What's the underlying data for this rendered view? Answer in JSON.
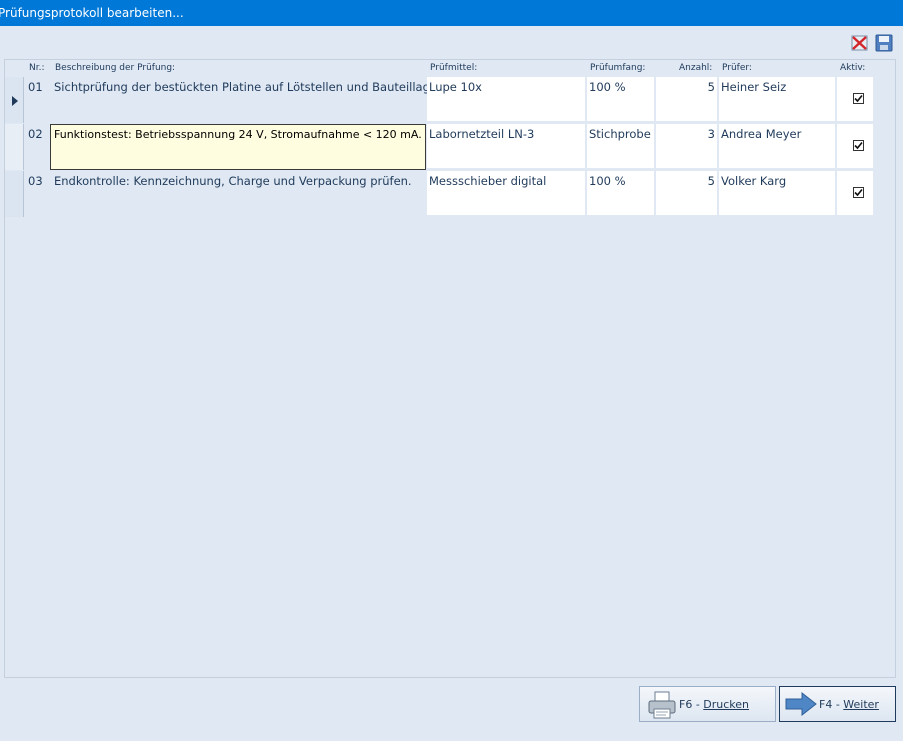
{
  "window": {
    "title": "Prüfungsprotokoll bearbeiten..."
  },
  "toolbar": {
    "icons": [
      "delete-icon",
      "save-icon"
    ]
  },
  "columns": {
    "nr": "Nr.:",
    "beschreibung": "Beschreibung der Prüfung:",
    "pruefmittel": "Prüfmittel:",
    "pruefumfang": "Prüfumfang:",
    "anzahl": "Anzahl:",
    "pruefer": "Prüfer:",
    "aktiv": "Aktiv:"
  },
  "rows": [
    {
      "nr": "01",
      "beschreibung": "Sichtprüfung der bestückten Platine auf Lötstellen und Bauteillage.",
      "pruefmittel": "Lupe 10x",
      "pruefumfang": "100 %",
      "anzahl": "5",
      "pruefer": "Heiner Seiz",
      "aktiv": true
    },
    {
      "nr": "02",
      "beschreibung": "Funktionstest: Betriebsspannung 24 V, Stromaufnahme < 120 mA.",
      "pruefmittel": "Labornetzteil LN-3",
      "pruefumfang": "Stichprobe",
      "anzahl": "3",
      "pruefer": "Andrea Meyer",
      "aktiv": true
    },
    {
      "nr": "03",
      "beschreibung": "Endkontrolle: Kennzeichnung, Charge und Verpackung prüfen.",
      "pruefmittel": "Messschieber digital",
      "pruefumfang": "100 %",
      "anzahl": "5",
      "pruefer": "Volker Karg",
      "aktiv": true
    }
  ],
  "buttons": {
    "print": {
      "key": "F6 - ",
      "label": "Drucken",
      "icon": "printer-icon"
    },
    "next": {
      "key": "F4 - ",
      "label": "Weiter",
      "icon": "arrow-right-icon"
    }
  },
  "colors": {
    "titlebar": "#0078d7",
    "background": "#dfe8f3",
    "edit_highlight": "#fffde0",
    "text": "#1f3a5a"
  }
}
